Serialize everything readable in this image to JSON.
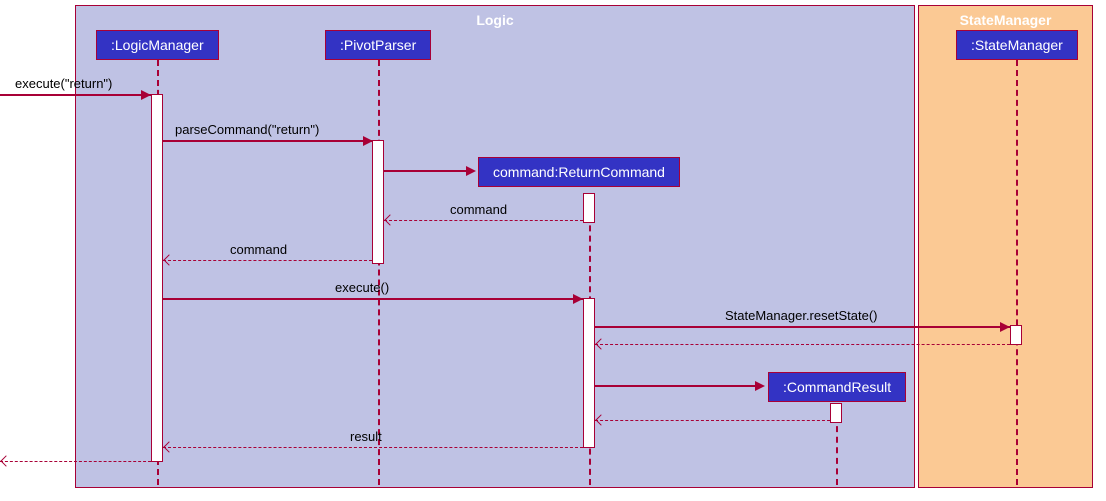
{
  "boxes": {
    "logic": {
      "title": "Logic"
    },
    "state": {
      "title": "StateManager"
    }
  },
  "participants": {
    "logicManager": ":LogicManager",
    "pivotParser": ":PivotParser",
    "returnCommand": "command:ReturnCommand",
    "commandResult": ":CommandResult",
    "stateManager": ":StateManager"
  },
  "messages": {
    "m1": "execute(\"return\")",
    "m2": "parseCommand(\"return\")",
    "m3": "command",
    "m4": "command",
    "m5": "execute()",
    "m6": "StateManager.resetState()",
    "m7": "result"
  },
  "lifelines_x": {
    "logicManager": 157,
    "pivotParser": 378,
    "returnCommand": 589,
    "commandResult": 836,
    "stateManager": 1016
  }
}
